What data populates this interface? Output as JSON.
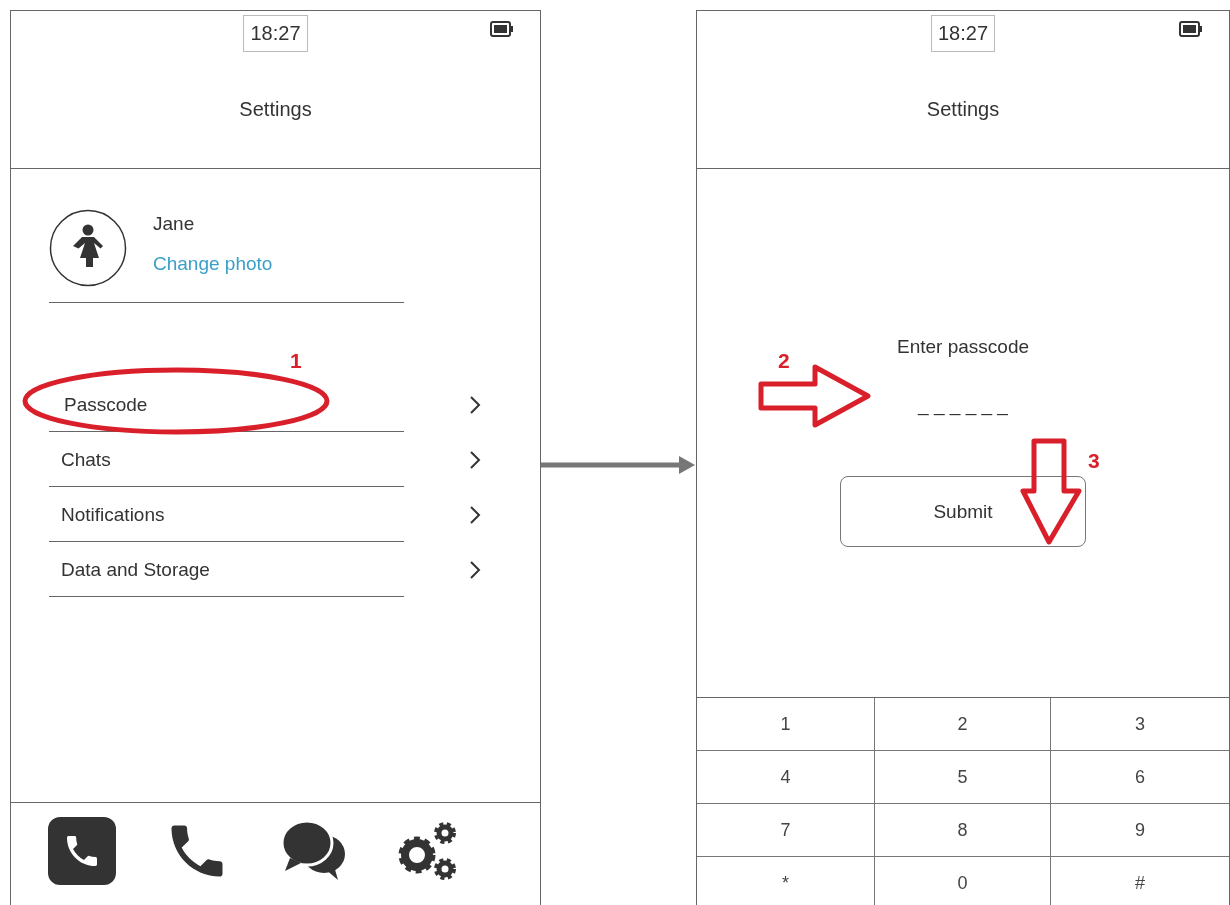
{
  "screens": [
    {
      "status": {
        "time": "18:27"
      },
      "title": "Settings",
      "profile": {
        "name": "Jane",
        "link": "Change photo"
      },
      "menu": [
        {
          "label": "Passcode"
        },
        {
          "label": "Chats"
        },
        {
          "label": "Notifications"
        },
        {
          "label": "Data and Storage"
        }
      ],
      "nav": [
        {
          "kind": "phone",
          "selected": true
        },
        {
          "kind": "phone",
          "selected": false
        },
        {
          "kind": "chat",
          "selected": false
        },
        {
          "kind": "settings",
          "selected": false
        }
      ]
    },
    {
      "status": {
        "time": "18:27"
      },
      "title": "Settings",
      "prompt": "Enter passcode",
      "passcode": {
        "placeholder": "_ _ _ _ _ _"
      },
      "button": "Submit",
      "keypad": [
        [
          "1",
          "2",
          "3"
        ],
        [
          "4",
          "5",
          "6"
        ],
        [
          "7",
          "8",
          "9"
        ],
        [
          "*",
          "0",
          "#"
        ]
      ]
    }
  ],
  "annotations": [
    {
      "kind": "ellipse",
      "label": "1"
    },
    {
      "kind": "arrow-right",
      "label": "2"
    },
    {
      "kind": "arrow-down",
      "label": "3"
    }
  ]
}
